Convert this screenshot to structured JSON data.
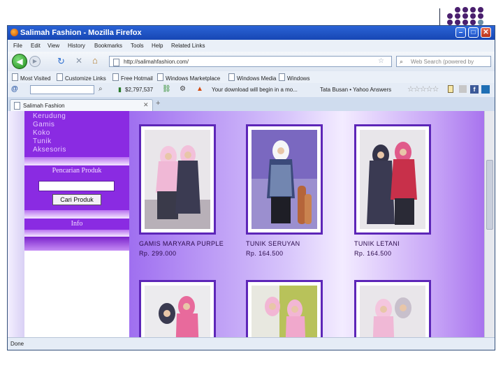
{
  "window": {
    "title": "Salimah Fashion - Mozilla Firefox",
    "controls": {
      "minimize": "–",
      "maximize": "□",
      "close": "✕"
    }
  },
  "menu": [
    "File",
    "Edit",
    "View",
    "History",
    "Bookmarks",
    "Tools",
    "Help",
    "Related Links"
  ],
  "nav": {
    "url": "http://salimahfashion.com/",
    "search_placeholder": "Web Search (powered by"
  },
  "bookmarks": [
    "Most Visited",
    "Customize Links",
    "Free Hotmail",
    "Windows Marketplace",
    "Windows Media",
    "Windows"
  ],
  "toolbar2": {
    "count": "$2,797,537",
    "download_text": "Your download will begin in a mo...",
    "links_text": "Tata Busan • Yahoo Answers"
  },
  "tab": {
    "label": "Salimah Fashion",
    "new_tab": "+"
  },
  "sidebar": {
    "categories": [
      "Kerudung",
      "Gamis",
      "Koko",
      "Tunik",
      "Aksesoris"
    ],
    "search_heading": "Pencarian Produk",
    "search_button": "Cari Produk",
    "info_heading": "Info"
  },
  "products": [
    {
      "name": "GAMIS MARYARA PURPLE",
      "price": "Rp. 299.000"
    },
    {
      "name": "TUNIK SERUYAN",
      "price": "Rp. 164.500"
    },
    {
      "name": "TUNIK LETANI",
      "price": "Rp. 164.500"
    },
    {
      "name": "",
      "price": ""
    },
    {
      "name": "",
      "price": ""
    },
    {
      "name": "",
      "price": ""
    }
  ],
  "status": "Done",
  "colors": {
    "sidebar": "#8a2be2",
    "frame": "#5d26b8",
    "deco_dots": "#4a1f6e",
    "deco_dot_accent": "#6b8fa6",
    "titlebar": "#2a63d6"
  }
}
